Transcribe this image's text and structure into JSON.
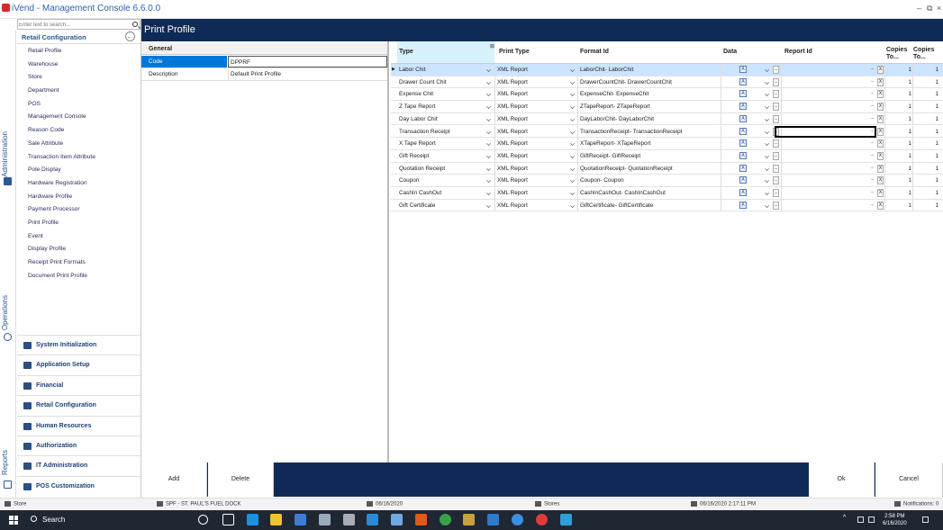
{
  "window": {
    "title": "iVend - Management Console  6.6.0.0",
    "minimize": "–",
    "restore": "⧉",
    "close": "×"
  },
  "sidebar": {
    "search_placeholder": "Enter text to search...",
    "vertical_tabs": [
      "Administration",
      "Operations",
      "Reports"
    ],
    "section_title": "Retail Configuration",
    "items": [
      "Retail Profile",
      "Warehouse",
      "Store",
      "Department",
      "POS",
      "Management Console",
      "Reason Code",
      "Sale Attribute",
      "Transaction Item Attribute",
      "Pole Display",
      "Hardware Registration",
      "Hardware Profile",
      "Payment Processor",
      "Print Profile",
      "Event",
      "Display Profile",
      "Receipt Print Formats",
      "Document Print Profile"
    ],
    "groups": [
      "System Initialization",
      "Application Setup",
      "Financial",
      "Retail Configuration",
      "Human Resources",
      "Authorization",
      "IT Administration",
      "POS Customization"
    ]
  },
  "page": {
    "title": "Print Profile"
  },
  "general": {
    "header": "General",
    "fields": [
      {
        "label": "Code",
        "value": "DPPRF"
      },
      {
        "label": "Description",
        "value": "Default Print Profile"
      }
    ]
  },
  "grid": {
    "columns": [
      "Type",
      "Print Type",
      "Format Id",
      "Data",
      "Report Id",
      "Copies To...",
      "Copies To..."
    ],
    "rows": [
      {
        "type": "Labor Chit",
        "print_type": "XML Report",
        "format_id": "LaborChit- LaborChit",
        "copies1": "1",
        "copies2": "1"
      },
      {
        "type": "Drawer Count Chit",
        "print_type": "XML Report",
        "format_id": "DrawerCountChit- DrawerCountChit",
        "copies1": "1",
        "copies2": "1"
      },
      {
        "type": "Expense Chit",
        "print_type": "XML Report",
        "format_id": "ExpenseChit- ExpenseChit",
        "copies1": "1",
        "copies2": "1"
      },
      {
        "type": "Z Tape Report",
        "print_type": "XML Report",
        "format_id": "ZTapeReport- ZTapeReport",
        "copies1": "1",
        "copies2": "1"
      },
      {
        "type": "Day Labor Chit",
        "print_type": "XML Report",
        "format_id": "DayLaborChit- DayLaborChit",
        "copies1": "1",
        "copies2": "1"
      },
      {
        "type": "Transaction Receipt",
        "print_type": "XML Report",
        "format_id": "TransactionReceipt- TransactionReceipt",
        "copies1": "1",
        "copies2": "1"
      },
      {
        "type": "X Tape Report",
        "print_type": "XML Report",
        "format_id": "XTapeReport- XTapeReport",
        "copies1": "1",
        "copies2": "1"
      },
      {
        "type": "Gift Receipt",
        "print_type": "XML Report",
        "format_id": "GiftReceipt- GiftReceipt",
        "copies1": "1",
        "copies2": "1"
      },
      {
        "type": "Quotation Receipt",
        "print_type": "XML Report",
        "format_id": "QuotationReceipt- QuotationReceipt",
        "copies1": "1",
        "copies2": "1"
      },
      {
        "type": "Coupon",
        "print_type": "XML Report",
        "format_id": "Coupon- Coupon",
        "copies1": "1",
        "copies2": "1"
      },
      {
        "type": "CashIn CashOut",
        "print_type": "XML Report",
        "format_id": "CashInCashOut- CashInCashOut",
        "copies1": "1",
        "copies2": "1"
      },
      {
        "type": "Gift Certificate",
        "print_type": "XML Report",
        "format_id": "GiftCertificate- GiftCertificate",
        "copies1": "1",
        "copies2": "1"
      }
    ],
    "data_glyph": "A",
    "ellipsis": "...",
    "clear": "X"
  },
  "buttons": {
    "add": "Add",
    "delete": "Delete",
    "ok": "Ok",
    "cancel": "Cancel"
  },
  "status": {
    "store": "Store",
    "location": "SPF - ST. PAUL'S FUEL DOCK",
    "date": "06/16/2020",
    "stores": "Stores",
    "datetime": "06/16/2020 2:17:11 PM",
    "notifications": "Notifications: 0"
  },
  "taskbar": {
    "search_label": "Search",
    "time": "2:58 PM",
    "date": "6/16/2020"
  },
  "colors": {
    "accent": "#0f2a56",
    "selected": "#0078d7",
    "row_highlight": "#cce4ff"
  }
}
